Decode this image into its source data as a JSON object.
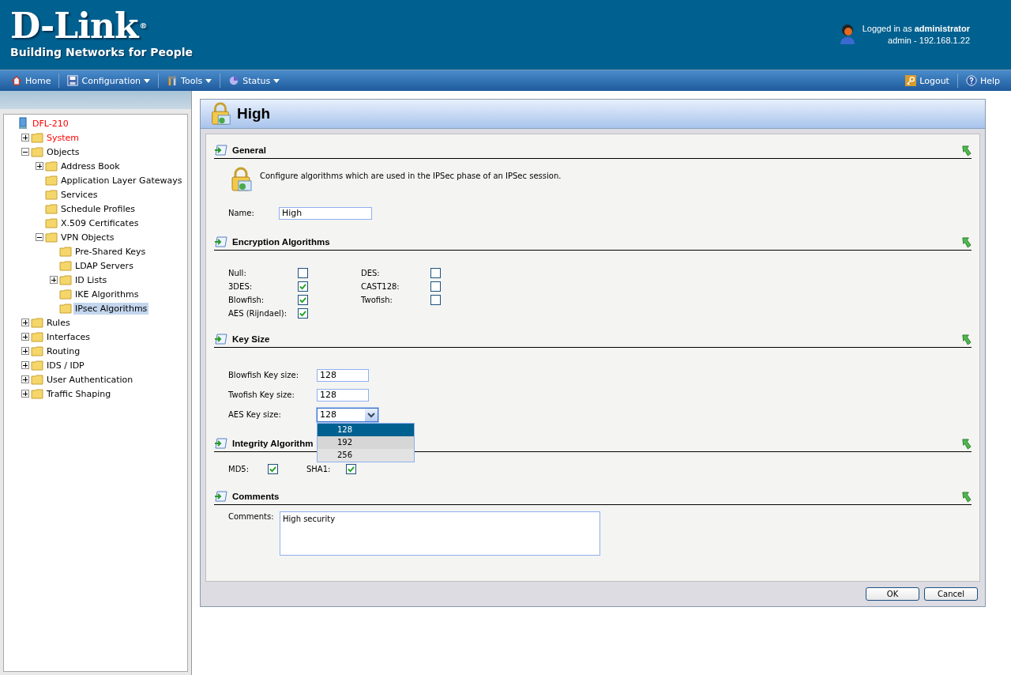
{
  "header": {
    "logo": "D-Link",
    "logo_mark": "®",
    "tagline": "Building Networks for People",
    "login": "Logged in as **administrator**",
    "login_detail": "admin - 192.168.1.22"
  },
  "menu": {
    "left": [
      {
        "label": "Home",
        "caret": false
      },
      {
        "label": "Configuration",
        "caret": true
      },
      {
        "label": "Tools",
        "caret": true
      },
      {
        "label": "Status",
        "caret": true
      }
    ],
    "right": [
      {
        "label": "Logout",
        "caret": false
      },
      {
        "label": "Help",
        "caret": false
      }
    ]
  },
  "tree": [
    {
      "label": "DFL-210",
      "selected": false,
      "color": "#ff0000",
      "children": [
        {
          "label": "System",
          "selected": false,
          "color": "#ff0000",
          "expanded": false
        },
        {
          "label": "Objects",
          "selected": false,
          "expanded": true,
          "children": [
            {
              "label": "Address Book",
              "selected": false,
              "expanded": false
            },
            {
              "label": "Application Layer Gateways",
              "selected": false
            },
            {
              "label": "Services",
              "selected": false
            },
            {
              "label": "Schedule Profiles",
              "selected": false
            },
            {
              "label": "X.509 Certificates",
              "selected": false
            },
            {
              "label": "VPN Objects",
              "selected": false,
              "expanded": true,
              "children": [
                {
                  "label": "Pre-Shared Keys",
                  "selected": false
                },
                {
                  "label": "LDAP Servers",
                  "selected": false
                },
                {
                  "label": "ID Lists",
                  "selected": false,
                  "expanded": false
                },
                {
                  "label": "IKE Algorithms",
                  "selected": false
                },
                {
                  "label": "IPsec Algorithms",
                  "selected": true
                }
              ]
            }
          ]
        },
        {
          "label": "Rules",
          "selected": false,
          "expanded": false
        },
        {
          "label": "Interfaces",
          "selected": false,
          "expanded": false
        },
        {
          "label": "Routing",
          "selected": false,
          "expanded": false
        },
        {
          "label": "IDS / IDP",
          "selected": false,
          "expanded": false
        },
        {
          "label": "User Authentication",
          "selected": false,
          "expanded": false
        },
        {
          "label": "Traffic Shaping",
          "selected": false,
          "expanded": false
        }
      ]
    }
  ],
  "panel": {
    "title": "High",
    "sections": [
      {
        "kind": "general",
        "title": "General",
        "description": "Configure algorithms which are used in the IPSec phase of an IPSec session.",
        "fields": [
          {
            "label": "Name:",
            "value": "High"
          }
        ]
      },
      {
        "kind": "checkgrid",
        "title": "Encryption Algorithms",
        "columns": [
          [
            {
              "label": "Null:",
              "checked": false
            },
            {
              "label": "3DES:",
              "checked": true
            },
            {
              "label": "Blowfish:",
              "checked": true
            },
            {
              "label": "AES (Rijndael):",
              "checked": true
            }
          ],
          [
            {
              "label": "DES:",
              "checked": false
            },
            {
              "label": "CAST128:",
              "checked": false
            },
            {
              "label": "Twofish:",
              "checked": false
            }
          ]
        ]
      },
      {
        "kind": "fields",
        "title": "Key Size",
        "fields": [
          {
            "label": "Blowfish Key size:",
            "value": "128",
            "kind": "text"
          },
          {
            "label": "Twofish Key size:",
            "value": "128",
            "kind": "text"
          },
          {
            "label": "AES Key size:",
            "value": "128",
            "kind": "select",
            "expanded": true,
            "options": [
              {
                "label": "128",
                "selected": true
              },
              {
                "label": "192",
                "selected": false
              },
              {
                "label": "256",
                "selected": false
              }
            ]
          }
        ]
      },
      {
        "kind": "checkrow",
        "title": "Integrity Algorithm",
        "items": [
          {
            "label": "MD5:",
            "checked": true
          },
          {
            "label": "SHA1:",
            "checked": true
          }
        ]
      },
      {
        "kind": "comments",
        "title": "Comments",
        "fields": [
          {
            "label": "Comments:",
            "value": "High security"
          }
        ]
      }
    ],
    "buttons": [
      "OK",
      "Cancel"
    ]
  }
}
